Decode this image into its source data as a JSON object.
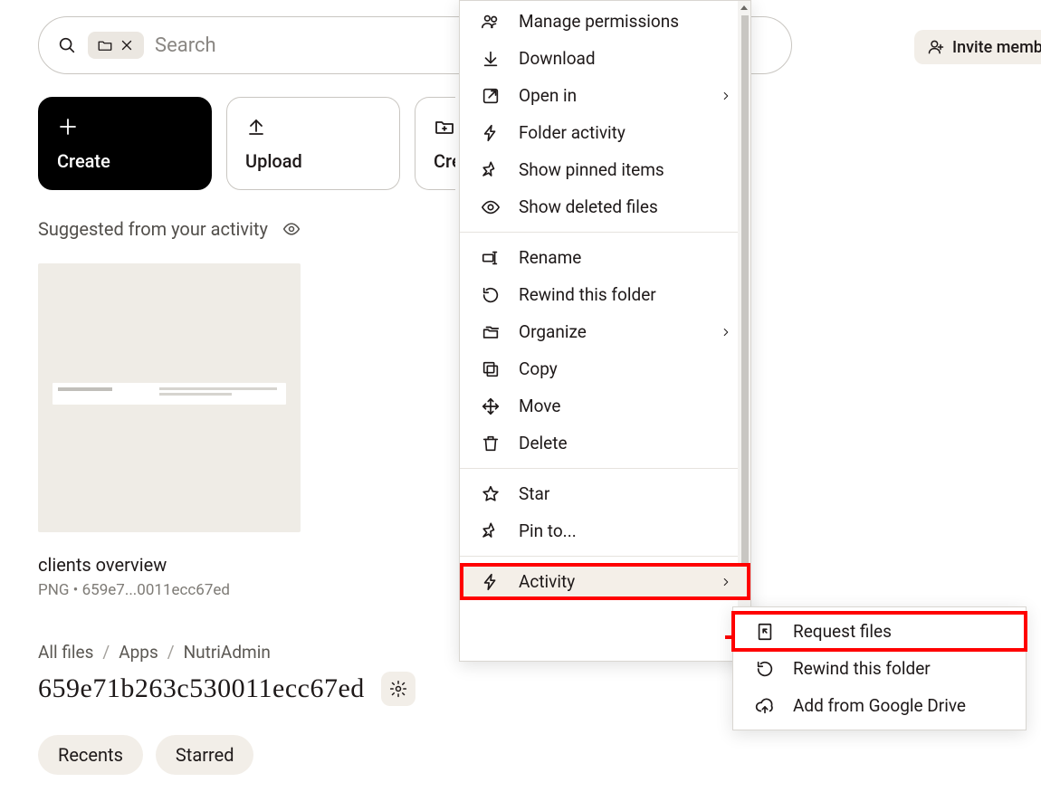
{
  "search": {
    "placeholder": "Search"
  },
  "header": {
    "invite_label": "Invite members"
  },
  "actions": {
    "create": "Create",
    "upload": "Upload",
    "create_partial": "Create folder"
  },
  "suggested_label": "Suggested from your activity",
  "file": {
    "title": "clients overview",
    "meta": "PNG • 659e7...0011ecc67ed"
  },
  "breadcrumb": [
    "All files",
    "Apps",
    "NutriAdmin"
  ],
  "folder_title": "659e71b263c530011ecc67ed",
  "pills": {
    "recents": "Recents",
    "starred": "Starred"
  },
  "menu": {
    "manage_permissions": "Manage permissions",
    "download": "Download",
    "open_in": "Open in",
    "folder_activity": "Folder activity",
    "show_pinned": "Show pinned items",
    "show_deleted": "Show deleted files",
    "rename": "Rename",
    "rewind": "Rewind this folder",
    "organize": "Organize",
    "copy": "Copy",
    "move": "Move",
    "delete": "Delete",
    "star": "Star",
    "pin_to": "Pin to...",
    "activity": "Activity"
  },
  "submenu": {
    "request_files": "Request files",
    "rewind": "Rewind this folder",
    "add_gdrive": "Add from Google Drive"
  }
}
